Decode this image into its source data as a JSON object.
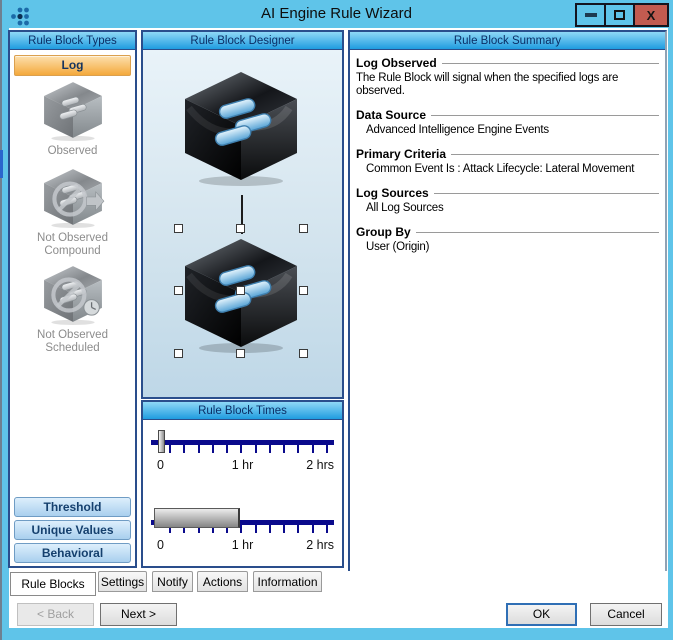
{
  "window": {
    "title": "AI Engine Rule Wizard",
    "close_glyph": "X"
  },
  "types": {
    "header": "Rule Block Types",
    "log_button": "Log",
    "items": [
      {
        "label": "Observed",
        "icon": "observed-cube-icon"
      },
      {
        "label": "Not Observed Compound",
        "icon": "not-observed-compound-cube-icon"
      },
      {
        "label": "Not Observed Scheduled",
        "icon": "not-observed-scheduled-cube-icon"
      }
    ],
    "bottom_buttons": [
      "Threshold",
      "Unique Values",
      "Behavioral"
    ]
  },
  "designer": {
    "header": "Rule Block Designer"
  },
  "times": {
    "header": "Rule Block Times",
    "sliders": [
      {
        "labels": [
          "0",
          "1 hr",
          "2 hrs"
        ]
      },
      {
        "labels": [
          "0",
          "1 hr",
          "2 hrs"
        ]
      }
    ]
  },
  "summary": {
    "header": "Rule Block Summary",
    "sections": [
      {
        "title": "Log Observed",
        "body": "The Rule Block will signal when the specified logs are observed."
      },
      {
        "title": "Data Source",
        "body": "Advanced Intelligence Engine Events"
      },
      {
        "title": "Primary Criteria",
        "body": "Common Event Is : Attack Lifecycle: Lateral Movement"
      },
      {
        "title": "Log Sources",
        "body": "All Log Sources"
      },
      {
        "title": "Group By",
        "body": "User (Origin)"
      }
    ]
  },
  "tabs": [
    "Rule Blocks",
    "Settings",
    "Notify",
    "Actions",
    "Information"
  ],
  "footer": {
    "back": "< Back",
    "next": "Next >",
    "ok": "OK",
    "cancel": "Cancel"
  },
  "colors": {
    "titlebar": "#5fc4e9",
    "close_button": "#c25b50",
    "panel_border": "#2a4e8c",
    "header_gradient_top": "#8fd8f6",
    "header_gradient_bottom": "#1f9ce0",
    "log_button_orange": "#f4a93c",
    "slider_track_navy": "#0a0a8c"
  }
}
